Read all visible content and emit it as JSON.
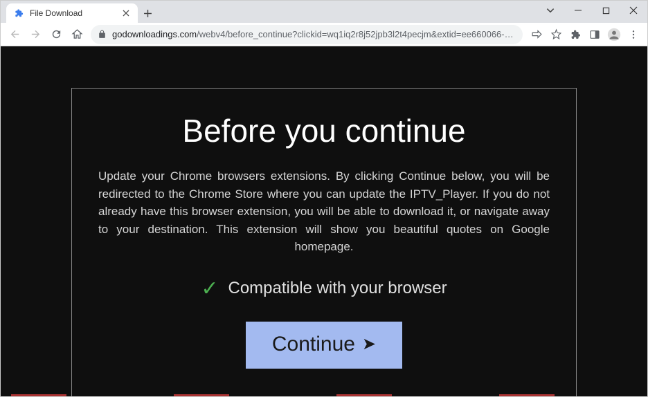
{
  "tab": {
    "title": "File Download"
  },
  "omnibox": {
    "domain": "godownloadings.com",
    "path": "/webv4/before_continue?clickid=wq1iq2r8j52jpb3l2t4pecjm&extid=ee660066-0576-4e29-ac69-9..."
  },
  "page": {
    "heading": "Before you continue",
    "body": "Update your Chrome browsers extensions. By clicking Continue below, you will be redirected to the Chrome Store where you can update the IPTV_Player. If you do not already have this browser extension, you will be able to download it, or navigate away to your destination. This extension will show you beautiful quotes on Google homepage.",
    "compat": "Compatible with your browser",
    "button": "Continue"
  }
}
